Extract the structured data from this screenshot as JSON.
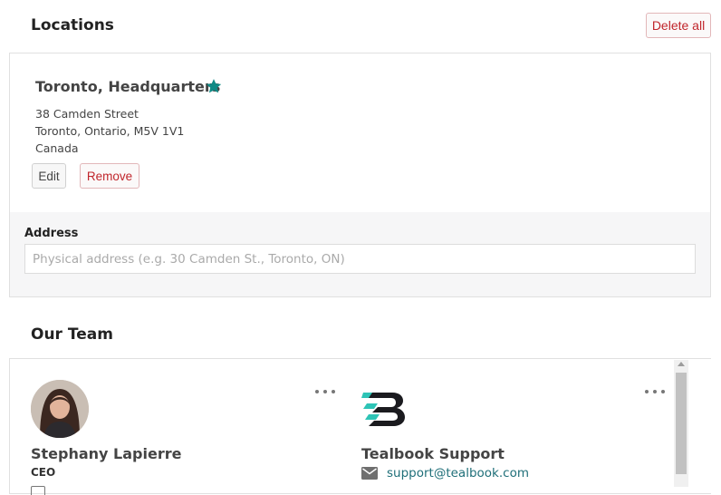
{
  "locations": {
    "title": "Locations",
    "delete_all_label": "Delete all",
    "location": {
      "name": "Toronto, Headquarters",
      "address_lines": [
        "38 Camden Street",
        "Toronto, Ontario, M5V 1V1",
        "Canada"
      ],
      "edit_label": "Edit",
      "remove_label": "Remove"
    },
    "address_form": {
      "label": "Address",
      "placeholder": "Physical address (e.g. 30 Camden St., Toronto, ON)",
      "value": ""
    }
  },
  "team": {
    "title": "Our Team",
    "members": [
      {
        "name": "Stephany Lapierre",
        "role": "CEO"
      },
      {
        "name": "Tealbook Support",
        "email": "support@tealbook.com"
      }
    ]
  },
  "colors": {
    "accent": "#0f8a85",
    "danger": "#c0252b",
    "link": "#1f6f79"
  },
  "icons": [
    "star-icon",
    "more-options-icon",
    "mail-icon",
    "tealbook-logo",
    "scroll-up-icon"
  ]
}
